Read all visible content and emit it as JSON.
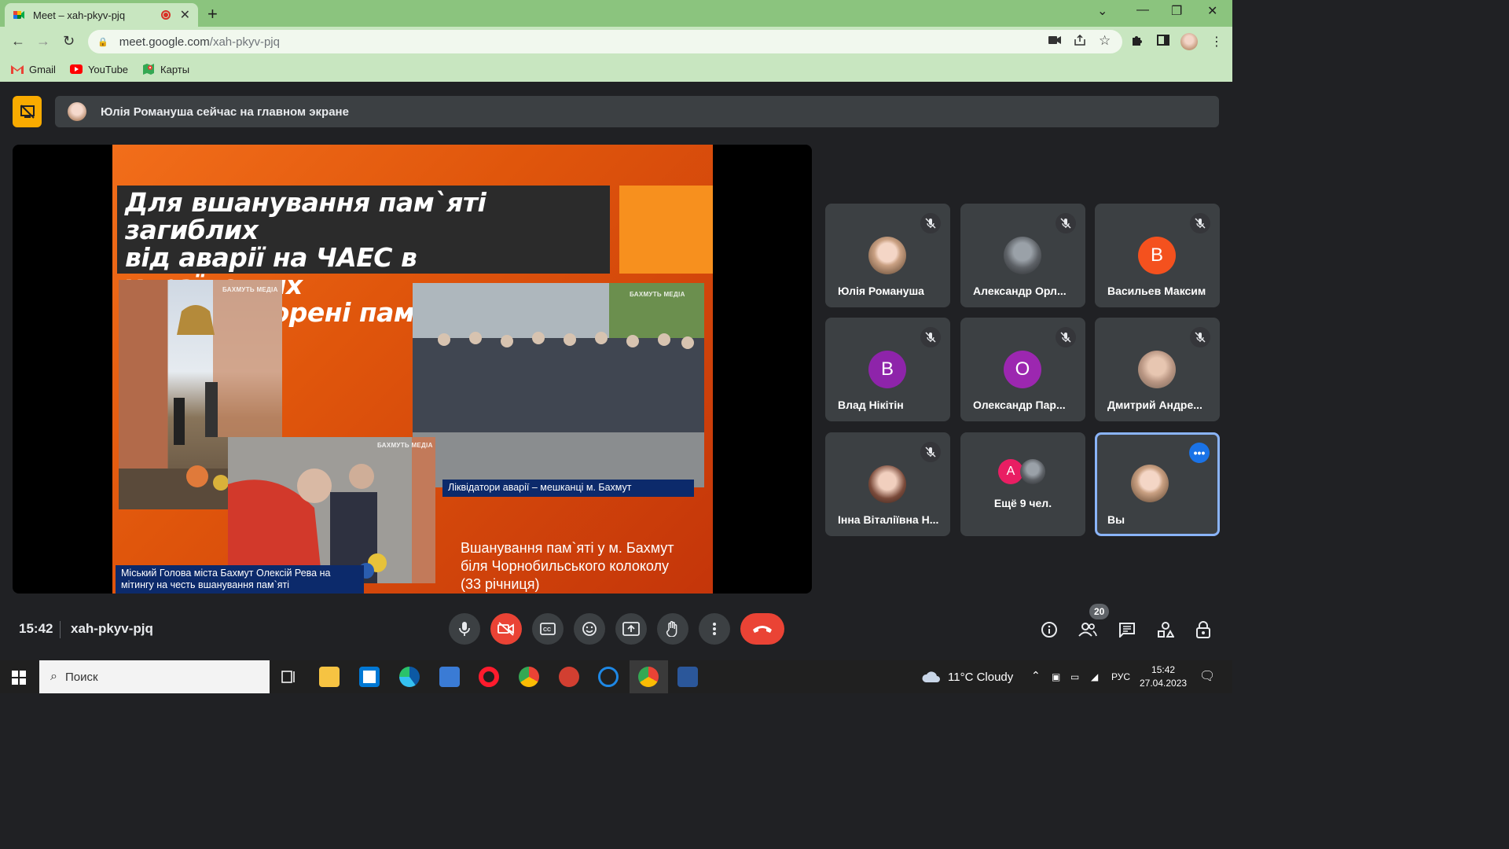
{
  "browser": {
    "tab_title": "Meet – xah-pkyv-pjq",
    "url_host": "meet.google.com",
    "url_path": "/xah-pkyv-pjq",
    "bookmarks": [
      {
        "label": "Gmail",
        "color": "#ea4335"
      },
      {
        "label": "YouTube",
        "color": "#ff0000"
      },
      {
        "label": "Карты",
        "color": "#34a853"
      }
    ]
  },
  "banner": {
    "text": "Юлія Романуша сейчас на главном экране"
  },
  "slide": {
    "title_line1": "Для вшанування пам`яті загиблих",
    "title_line2": "від аварії на ЧАЕС в українських",
    "title_line3": "містах створені пам`ятники",
    "watermark": "БАХМУТЬ МЕДІА",
    "caption_left": "Міський Голова міста Бахмут Олексій Рева на мітингу на честь вшанування пам`яті",
    "caption_right": "Ліквідатори аварії – мешканці м. Бахмут",
    "text_line1": "Вшанування пам`яті у м. Бахмут",
    "text_line2": "біля Чорнобильського колоколу",
    "text_line3": "(33 річниця)"
  },
  "participants": [
    {
      "name": "Юлія Романуша",
      "initial": "",
      "color": "",
      "muted": true
    },
    {
      "name": "Александр Орл...",
      "initial": "",
      "color": "",
      "muted": true
    },
    {
      "name": "Васильев Максим",
      "initial": "В",
      "color": "#f4511e",
      "muted": true
    },
    {
      "name": "Влад Нікітін",
      "initial": "В",
      "color": "#8e24aa",
      "muted": true
    },
    {
      "name": "Олександр Пар...",
      "initial": "О",
      "color": "#9c27b0",
      "muted": true
    },
    {
      "name": "Дмитрий Андре...",
      "initial": "",
      "color": "",
      "muted": true
    },
    {
      "name": "Інна Віталіївна Н...",
      "initial": "",
      "color": "",
      "muted": true
    },
    {
      "name": "Ещё 9 чел.",
      "initial": "A",
      "color": "#e91e63",
      "muted": false
    },
    {
      "name": "Вы",
      "initial": "",
      "color": "",
      "muted": false
    }
  ],
  "controls": {
    "time": "15:42",
    "meeting_code": "xah-pkyv-pjq",
    "participant_count": "20"
  },
  "taskbar": {
    "search_placeholder": "Поиск",
    "weather": "11°C  Cloudy",
    "lang": "РУС",
    "time": "15:42",
    "date": "27.04.2023"
  }
}
